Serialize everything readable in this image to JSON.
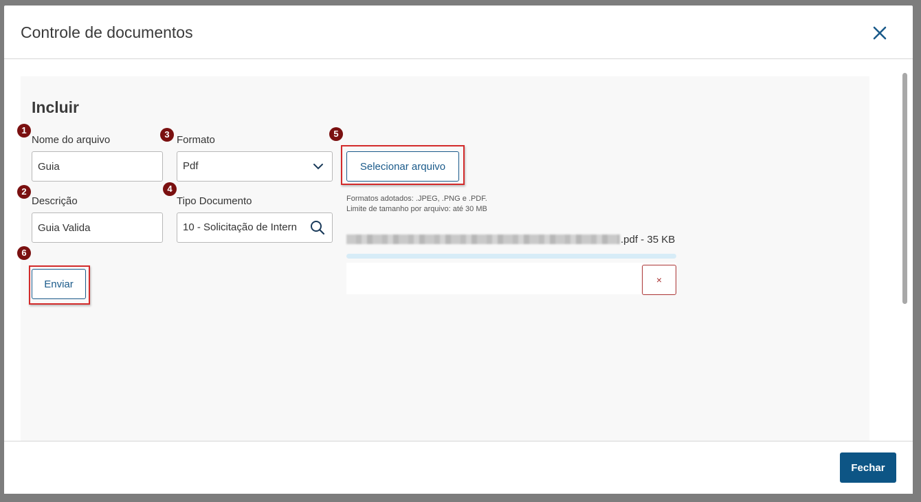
{
  "modal": {
    "title": "Controle de documentos",
    "close_icon": "close-icon"
  },
  "section": {
    "title": "Incluir"
  },
  "badges": [
    "1",
    "2",
    "3",
    "4",
    "5",
    "6"
  ],
  "fields": {
    "nome_do_arquivo": {
      "label": "Nome do arquivo",
      "value": "Guia"
    },
    "descricao": {
      "label": "Descrição",
      "value": "Guia Valida"
    },
    "formato": {
      "label": "Formato",
      "value": "Pdf"
    },
    "tipo_documento": {
      "label": "Tipo Documento",
      "value": "10 - Solicitação de Intern"
    }
  },
  "buttons": {
    "selecionar_arquivo": "Selecionar arquivo",
    "enviar": "Enviar",
    "fechar": "Fechar",
    "remove": "×"
  },
  "help": {
    "formats": "Formatos adotados: .JPEG, .PNG e .PDF.",
    "size_limit": "Limite de tamanho por arquivo: até 30 MB"
  },
  "file": {
    "name_suffix": ".pdf - 35 KB",
    "upload_progress": 0
  },
  "colors": {
    "accent": "#0d5585",
    "badge": "#7a1010",
    "highlight": "#d32a2a",
    "progress": "#d7ecf7"
  }
}
